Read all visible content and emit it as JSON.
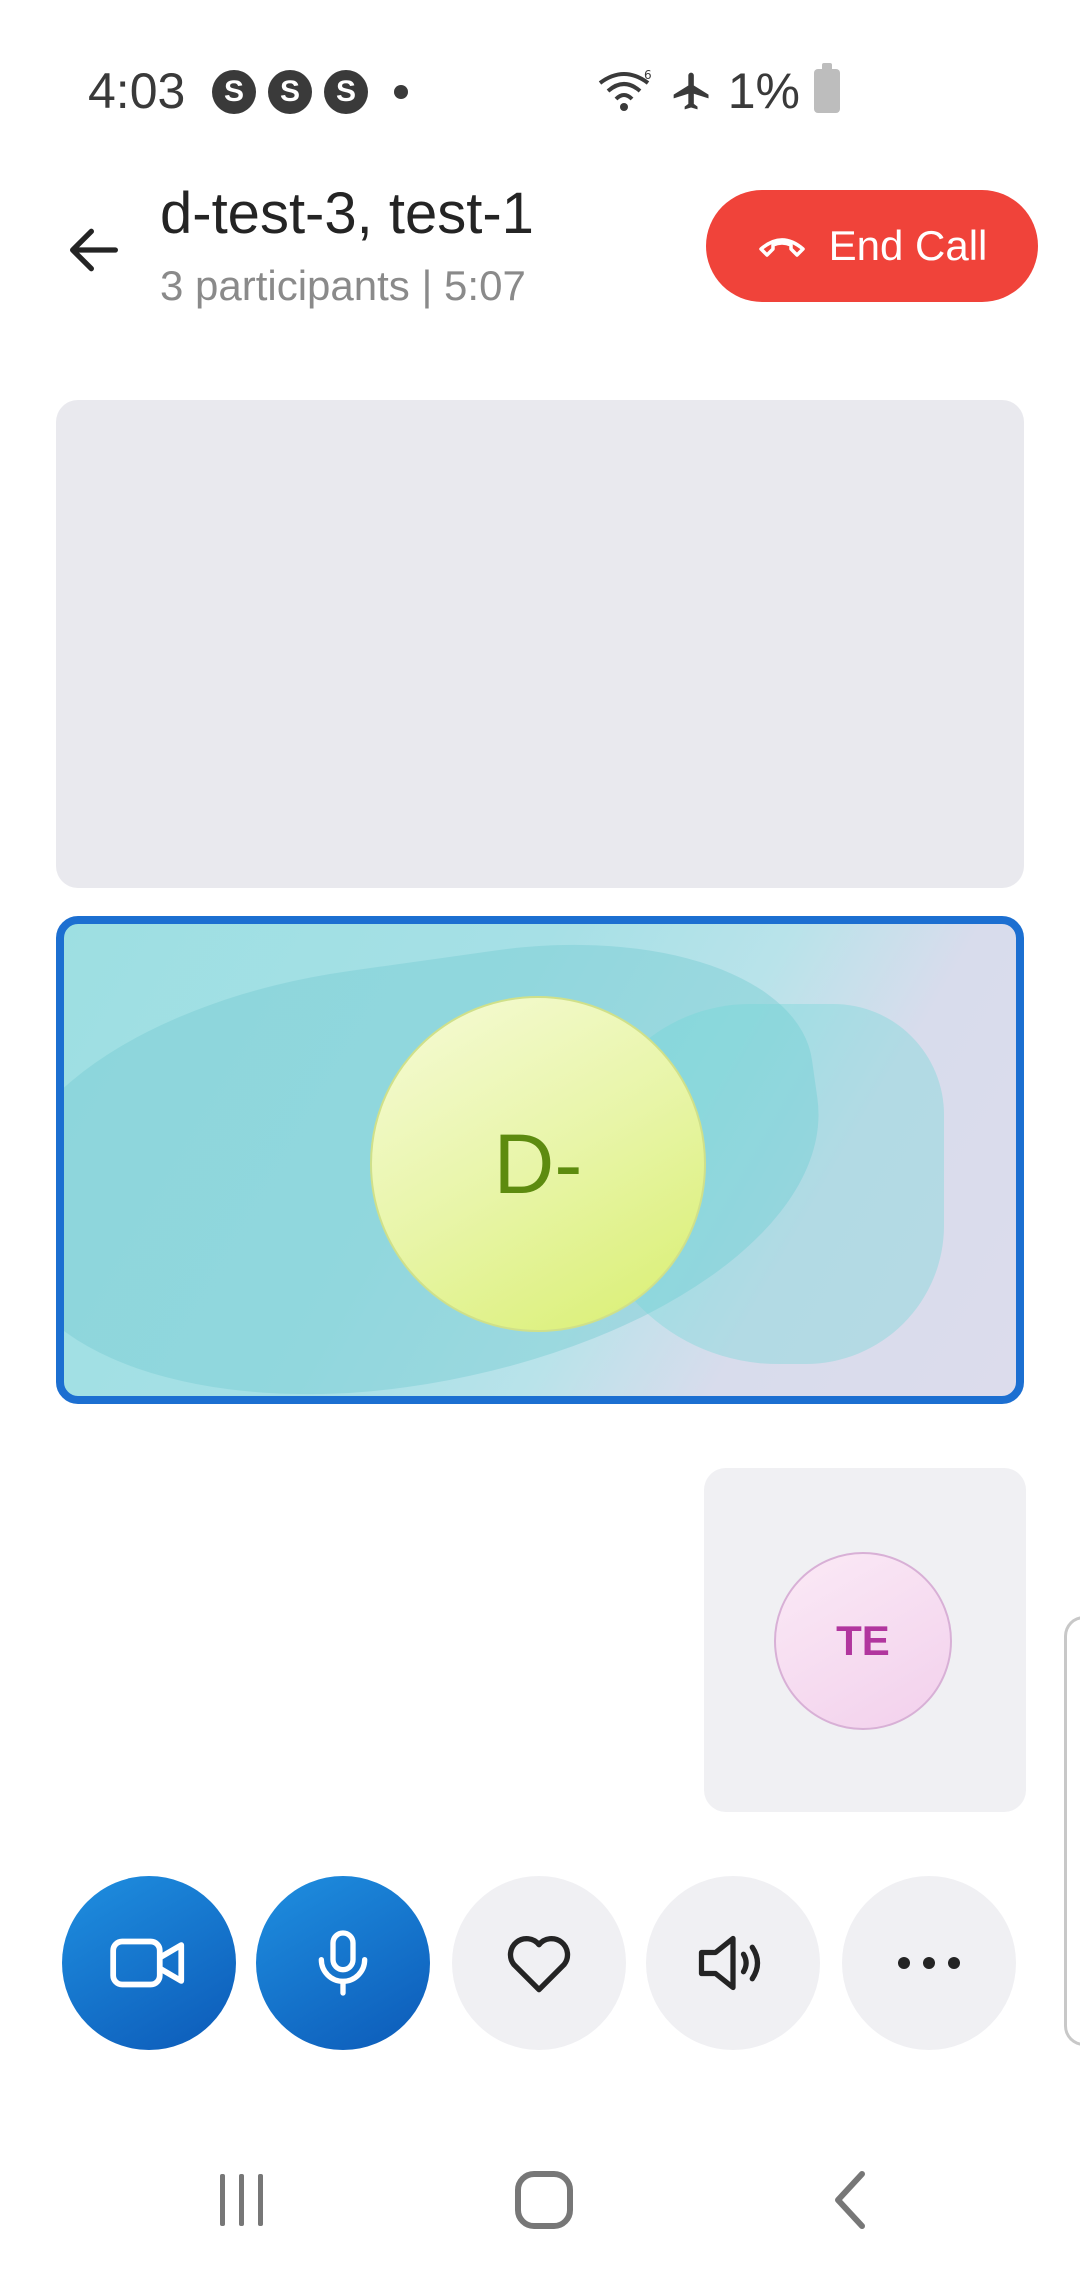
{
  "status_bar": {
    "time": "4:03",
    "notifications": [
      "S",
      "S",
      "S"
    ],
    "battery": "1%"
  },
  "header": {
    "title": "d-test-3, test-1",
    "subtitle": "3 participants | 5:07",
    "end_call_label": "End Call",
    "end_call_color": "#f0433a"
  },
  "tiles": {
    "main_initials": "D-",
    "small_initials": "TE",
    "active_border_color": "#1c6fd1"
  },
  "controls": [
    {
      "name": "camera",
      "icon": "video-camera-icon"
    },
    {
      "name": "microphone",
      "icon": "microphone-icon"
    },
    {
      "name": "reactions",
      "icon": "heart-icon"
    },
    {
      "name": "speaker",
      "icon": "speaker-icon"
    },
    {
      "name": "more",
      "icon": "more-icon"
    }
  ],
  "nav": [
    "recent-apps-icon",
    "home-icon",
    "back-icon"
  ]
}
